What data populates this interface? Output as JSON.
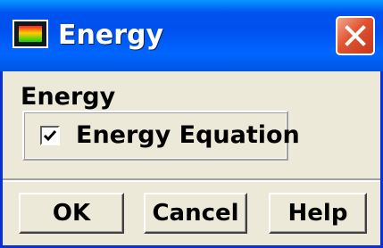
{
  "window": {
    "title": "Energy",
    "icon": "fluent-app-icon",
    "close_icon": "close-icon"
  },
  "group": {
    "label": "Energy",
    "options": [
      {
        "label": "Energy Equation",
        "checked": true
      }
    ]
  },
  "buttons": {
    "ok_label": "OK",
    "cancel_label": "Cancel",
    "help_label": "Help"
  },
  "colors": {
    "titlebar": "#0054e3",
    "dialog_background": "#ece9d8",
    "close_button": "#e0532f"
  }
}
